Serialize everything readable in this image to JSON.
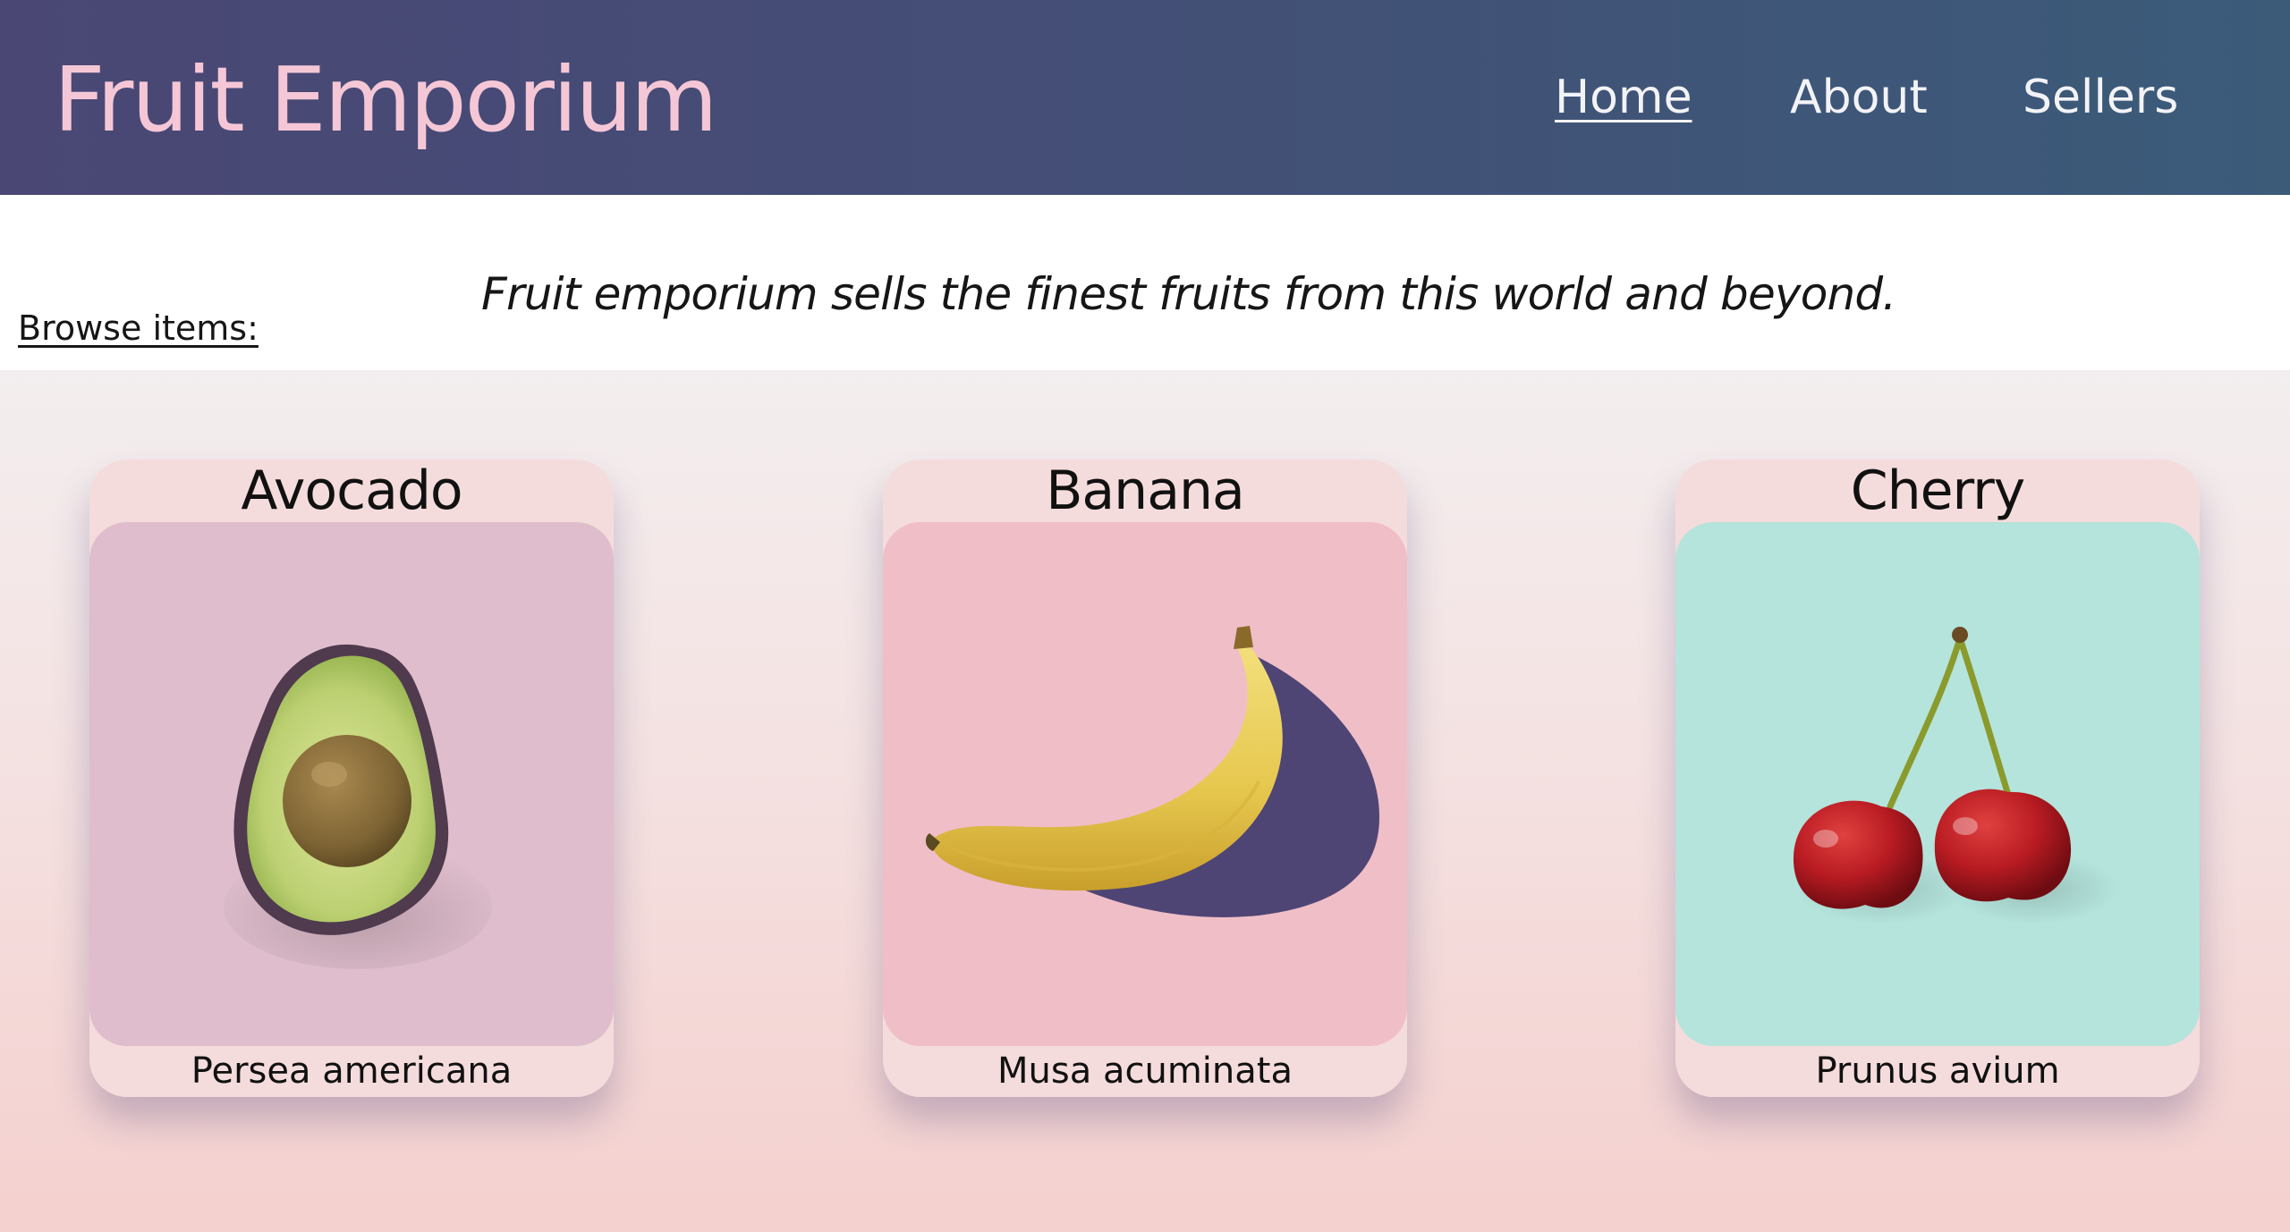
{
  "header": {
    "brand": "Fruit Emporium",
    "nav": [
      {
        "label": "Home",
        "active": true
      },
      {
        "label": "About",
        "active": false
      },
      {
        "label": "Sellers",
        "active": false
      }
    ]
  },
  "intro": {
    "tagline": "Fruit emporium sells the finest fruits from this world and beyond.",
    "browse_label": "Browse items:"
  },
  "products": [
    {
      "name": "Avocado",
      "scientific_name": "Persea americana",
      "icon": "avocado-icon",
      "bg_color": "#dfbdcc"
    },
    {
      "name": "Banana",
      "scientific_name": "Musa acuminata",
      "icon": "banana-icon",
      "bg_color": "#f0bec7"
    },
    {
      "name": "Cherry",
      "scientific_name": "Prunus avium",
      "icon": "cherry-icon",
      "bg_color": "#b4e4dc"
    }
  ],
  "colors": {
    "header_gradient_start": "#4a4775",
    "header_gradient_end": "#3b5b79",
    "brand_text": "#f5c7d6",
    "nav_text": "#f3f3f7",
    "card_bg": "#f5dcdc"
  }
}
